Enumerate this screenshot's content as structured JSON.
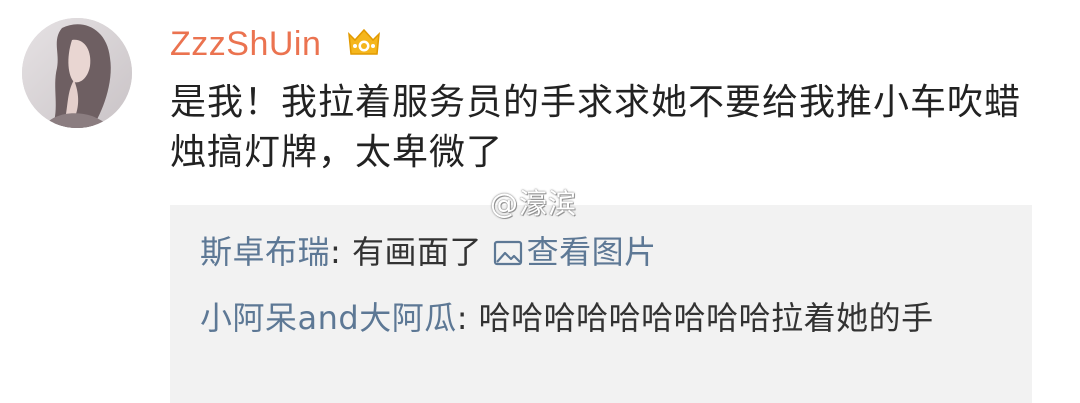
{
  "post": {
    "username": "ZzzShUin",
    "text": "是我！我拉着服务员的手求求她不要给我推小车吹蜡烛搞灯牌，太卑微了"
  },
  "watermark": "@濠滨",
  "comments": [
    {
      "author": "斯卓布瑞",
      "separator": ": ",
      "text": "有画面了 ",
      "link": "查看图片"
    },
    {
      "author": "小阿呆and大阿瓜",
      "separator": ": ",
      "text": "哈哈哈哈哈哈哈哈哈拉着她的手"
    }
  ],
  "colors": {
    "username": "#eb7350",
    "commenter": "#5d7895",
    "text": "#222222",
    "comment_bg": "#f2f2f2"
  },
  "icons": {
    "vip_badge": "yellow-vip-crown-icon",
    "image_link": "picture-icon"
  }
}
